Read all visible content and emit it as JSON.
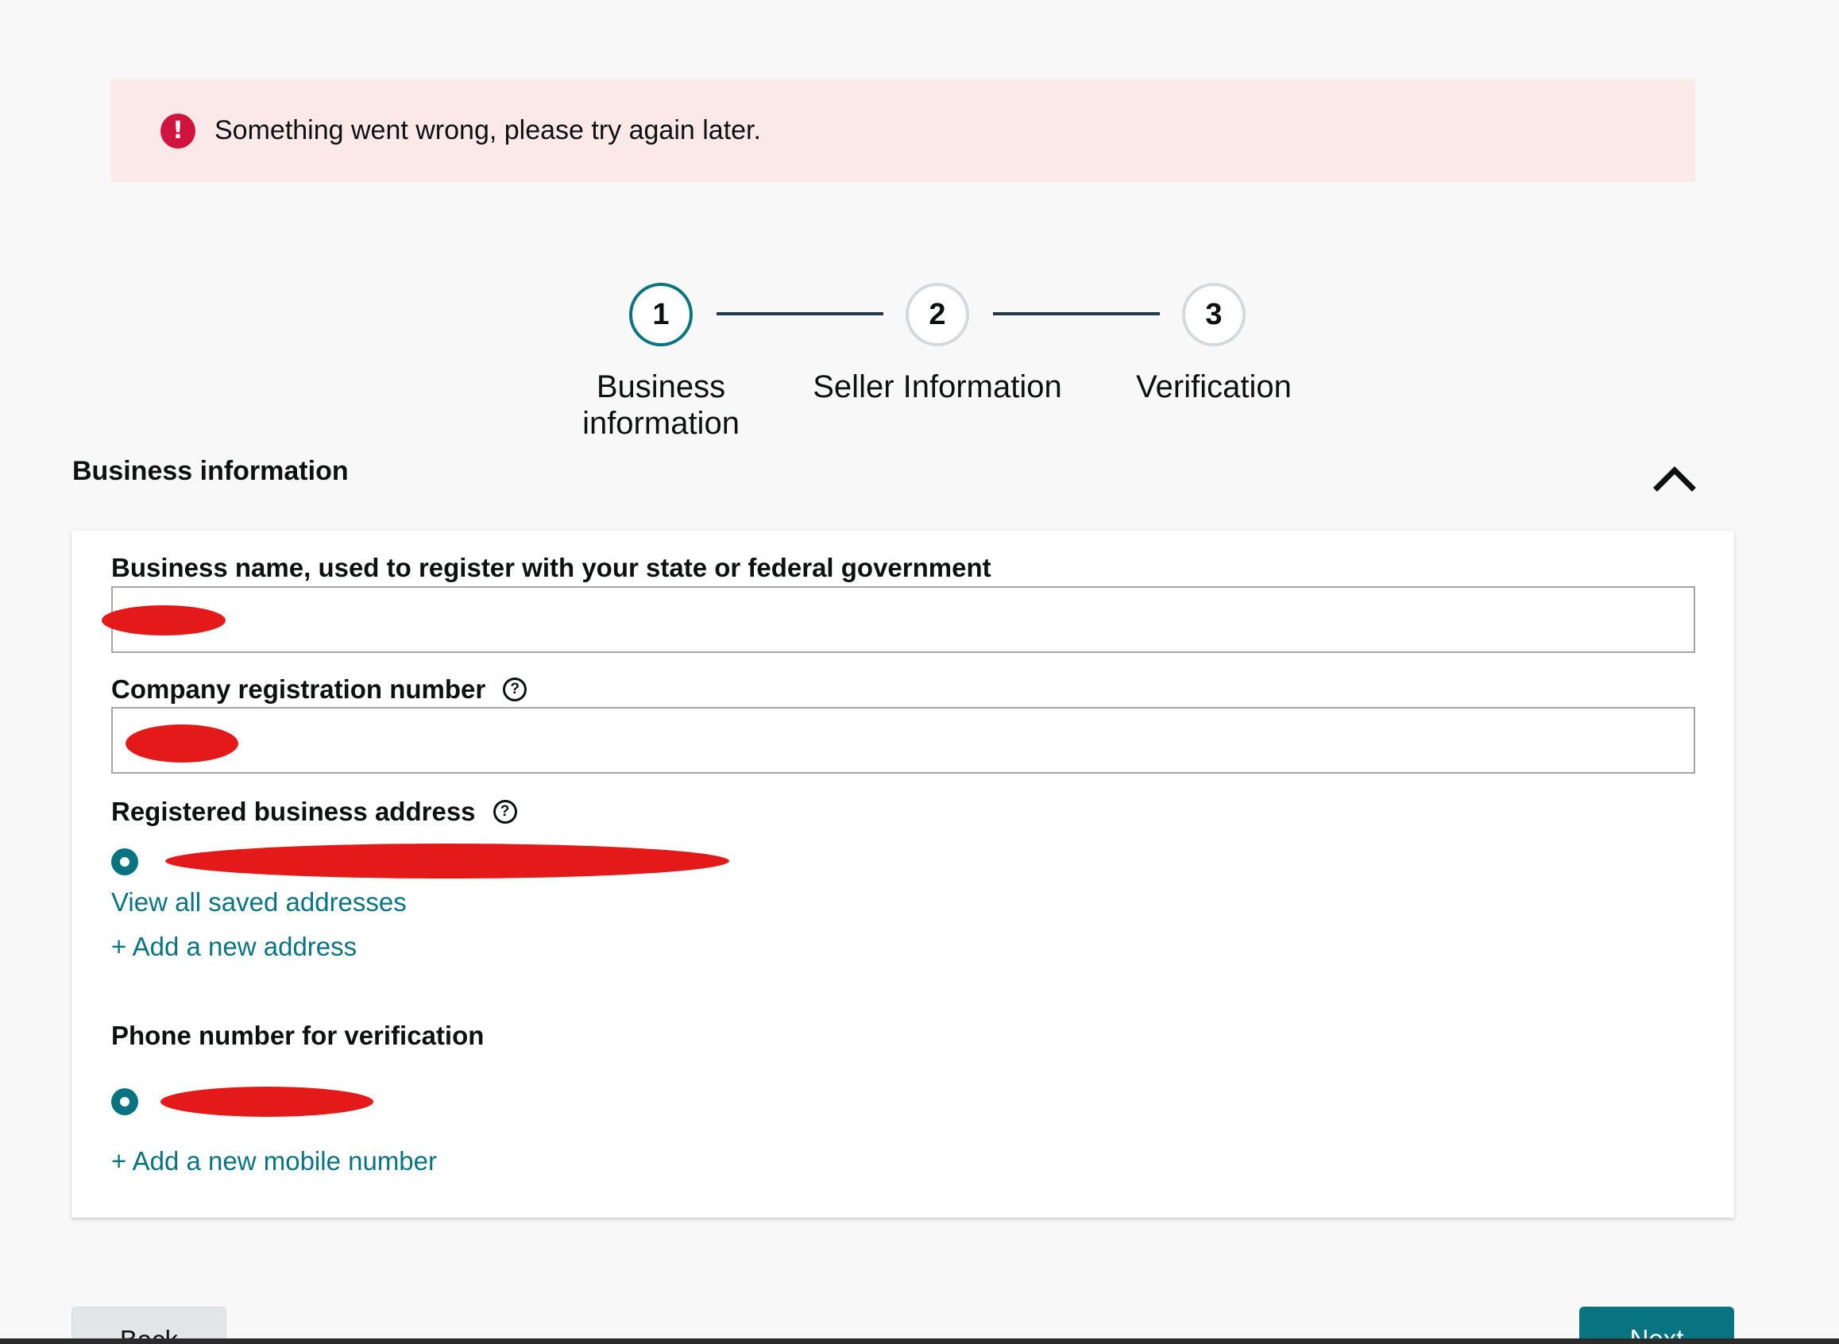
{
  "alert": {
    "message": "Something went wrong, please try again later.",
    "icon": "alert-circle-icon",
    "icon_glyph": "!",
    "background": "#fbe9e9",
    "icon_color": "#d0143e"
  },
  "stepper": {
    "steps": [
      {
        "number": "1",
        "label_line1": "Business",
        "label_line2": "information",
        "state": "active"
      },
      {
        "number": "2",
        "label_line1": "Seller Information",
        "label_line2": "",
        "state": "pending"
      },
      {
        "number": "3",
        "label_line1": "Verification",
        "label_line2": "",
        "state": "pending"
      }
    ],
    "active_color": "#087482"
  },
  "section": {
    "title": "Business information",
    "collapse_icon": "chevron-up-icon"
  },
  "form": {
    "business_name_label": "Business name, used to register with your state or federal government",
    "company_reg_label": "Company registration number",
    "address_label": "Registered business address",
    "view_saved_addresses": "View all saved addresses",
    "add_address": "+ Add a new address",
    "phone_label": "Phone number for verification",
    "add_mobile": "+ Add a new mobile number",
    "help_glyph": "?"
  },
  "buttons": {
    "back": "Back",
    "next": "Next"
  },
  "colors": {
    "link": "#087482",
    "primary": "#087482",
    "redaction": "#e41a1a"
  }
}
